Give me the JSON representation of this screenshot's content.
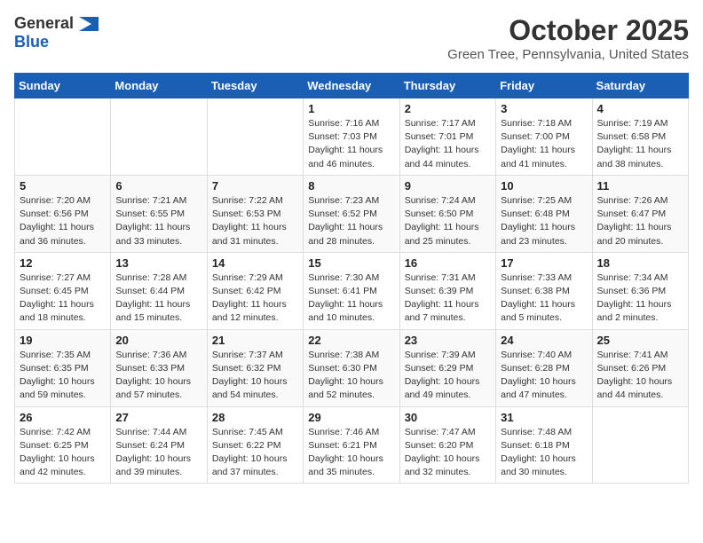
{
  "logo": {
    "general": "General",
    "blue": "Blue"
  },
  "title": "October 2025",
  "location": "Green Tree, Pennsylvania, United States",
  "days_of_week": [
    "Sunday",
    "Monday",
    "Tuesday",
    "Wednesday",
    "Thursday",
    "Friday",
    "Saturday"
  ],
  "weeks": [
    [
      {
        "day": "",
        "info": ""
      },
      {
        "day": "",
        "info": ""
      },
      {
        "day": "",
        "info": ""
      },
      {
        "day": "1",
        "info": "Sunrise: 7:16 AM\nSunset: 7:03 PM\nDaylight: 11 hours and 46 minutes."
      },
      {
        "day": "2",
        "info": "Sunrise: 7:17 AM\nSunset: 7:01 PM\nDaylight: 11 hours and 44 minutes."
      },
      {
        "day": "3",
        "info": "Sunrise: 7:18 AM\nSunset: 7:00 PM\nDaylight: 11 hours and 41 minutes."
      },
      {
        "day": "4",
        "info": "Sunrise: 7:19 AM\nSunset: 6:58 PM\nDaylight: 11 hours and 38 minutes."
      }
    ],
    [
      {
        "day": "5",
        "info": "Sunrise: 7:20 AM\nSunset: 6:56 PM\nDaylight: 11 hours and 36 minutes."
      },
      {
        "day": "6",
        "info": "Sunrise: 7:21 AM\nSunset: 6:55 PM\nDaylight: 11 hours and 33 minutes."
      },
      {
        "day": "7",
        "info": "Sunrise: 7:22 AM\nSunset: 6:53 PM\nDaylight: 11 hours and 31 minutes."
      },
      {
        "day": "8",
        "info": "Sunrise: 7:23 AM\nSunset: 6:52 PM\nDaylight: 11 hours and 28 minutes."
      },
      {
        "day": "9",
        "info": "Sunrise: 7:24 AM\nSunset: 6:50 PM\nDaylight: 11 hours and 25 minutes."
      },
      {
        "day": "10",
        "info": "Sunrise: 7:25 AM\nSunset: 6:48 PM\nDaylight: 11 hours and 23 minutes."
      },
      {
        "day": "11",
        "info": "Sunrise: 7:26 AM\nSunset: 6:47 PM\nDaylight: 11 hours and 20 minutes."
      }
    ],
    [
      {
        "day": "12",
        "info": "Sunrise: 7:27 AM\nSunset: 6:45 PM\nDaylight: 11 hours and 18 minutes."
      },
      {
        "day": "13",
        "info": "Sunrise: 7:28 AM\nSunset: 6:44 PM\nDaylight: 11 hours and 15 minutes."
      },
      {
        "day": "14",
        "info": "Sunrise: 7:29 AM\nSunset: 6:42 PM\nDaylight: 11 hours and 12 minutes."
      },
      {
        "day": "15",
        "info": "Sunrise: 7:30 AM\nSunset: 6:41 PM\nDaylight: 11 hours and 10 minutes."
      },
      {
        "day": "16",
        "info": "Sunrise: 7:31 AM\nSunset: 6:39 PM\nDaylight: 11 hours and 7 minutes."
      },
      {
        "day": "17",
        "info": "Sunrise: 7:33 AM\nSunset: 6:38 PM\nDaylight: 11 hours and 5 minutes."
      },
      {
        "day": "18",
        "info": "Sunrise: 7:34 AM\nSunset: 6:36 PM\nDaylight: 11 hours and 2 minutes."
      }
    ],
    [
      {
        "day": "19",
        "info": "Sunrise: 7:35 AM\nSunset: 6:35 PM\nDaylight: 10 hours and 59 minutes."
      },
      {
        "day": "20",
        "info": "Sunrise: 7:36 AM\nSunset: 6:33 PM\nDaylight: 10 hours and 57 minutes."
      },
      {
        "day": "21",
        "info": "Sunrise: 7:37 AM\nSunset: 6:32 PM\nDaylight: 10 hours and 54 minutes."
      },
      {
        "day": "22",
        "info": "Sunrise: 7:38 AM\nSunset: 6:30 PM\nDaylight: 10 hours and 52 minutes."
      },
      {
        "day": "23",
        "info": "Sunrise: 7:39 AM\nSunset: 6:29 PM\nDaylight: 10 hours and 49 minutes."
      },
      {
        "day": "24",
        "info": "Sunrise: 7:40 AM\nSunset: 6:28 PM\nDaylight: 10 hours and 47 minutes."
      },
      {
        "day": "25",
        "info": "Sunrise: 7:41 AM\nSunset: 6:26 PM\nDaylight: 10 hours and 44 minutes."
      }
    ],
    [
      {
        "day": "26",
        "info": "Sunrise: 7:42 AM\nSunset: 6:25 PM\nDaylight: 10 hours and 42 minutes."
      },
      {
        "day": "27",
        "info": "Sunrise: 7:44 AM\nSunset: 6:24 PM\nDaylight: 10 hours and 39 minutes."
      },
      {
        "day": "28",
        "info": "Sunrise: 7:45 AM\nSunset: 6:22 PM\nDaylight: 10 hours and 37 minutes."
      },
      {
        "day": "29",
        "info": "Sunrise: 7:46 AM\nSunset: 6:21 PM\nDaylight: 10 hours and 35 minutes."
      },
      {
        "day": "30",
        "info": "Sunrise: 7:47 AM\nSunset: 6:20 PM\nDaylight: 10 hours and 32 minutes."
      },
      {
        "day": "31",
        "info": "Sunrise: 7:48 AM\nSunset: 6:18 PM\nDaylight: 10 hours and 30 minutes."
      },
      {
        "day": "",
        "info": ""
      }
    ]
  ]
}
